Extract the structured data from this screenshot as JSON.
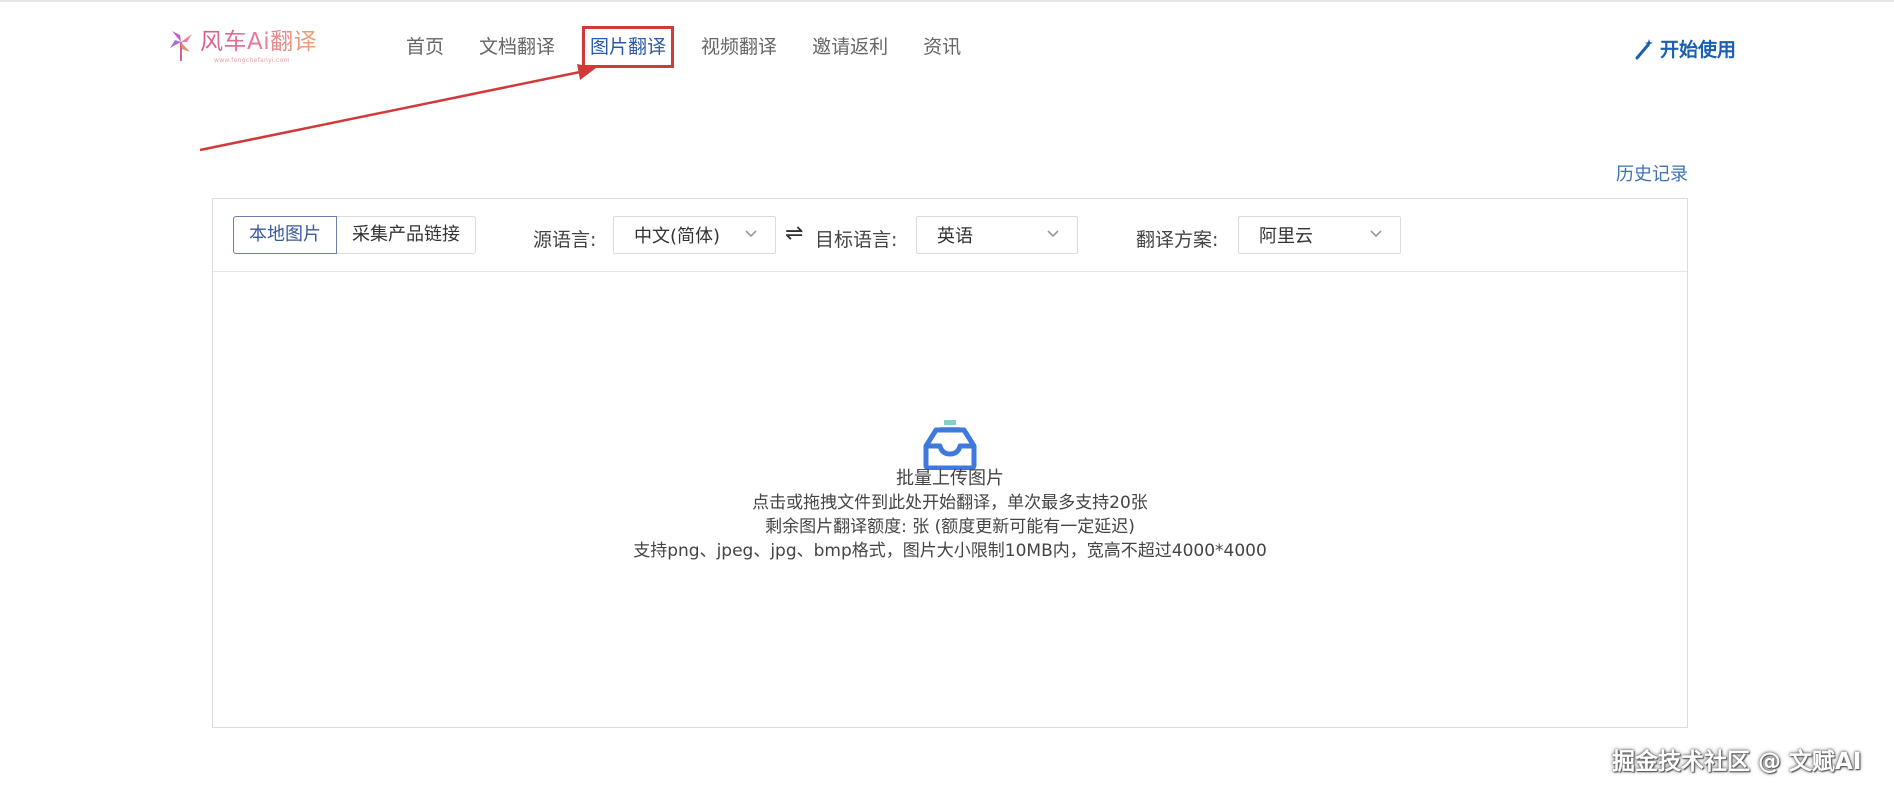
{
  "header": {
    "logo_text": "风车Ai翻译",
    "logo_subtext": "www.fengchefanyi.com",
    "nav": [
      {
        "label": "首页"
      },
      {
        "label": "文档翻译"
      },
      {
        "label": "图片翻译"
      },
      {
        "label": "视频翻译"
      },
      {
        "label": "邀请返利"
      },
      {
        "label": "资讯"
      }
    ],
    "start_label": "开始使用"
  },
  "history_label": "历史记录",
  "toolbar": {
    "tabs": [
      {
        "label": "本地图片"
      },
      {
        "label": "采集产品链接"
      }
    ],
    "source_label": "源语言:",
    "source_value": "中文(简体)",
    "swap_symbol": "⇌",
    "target_label": "目标语言:",
    "target_value": "英语",
    "plan_label": "翻译方案:",
    "plan_value": "阿里云"
  },
  "upload": {
    "title": "批量上传图片",
    "line1": "点击或拖拽文件到此处开始翻译，单次最多支持20张",
    "line2": "剩余图片翻译额度: 张 (额度更新可能有一定延迟)",
    "line3": "支持png、jpeg、jpg、bmp格式，图片大小限制10MB内，宽高不超过4000*4000"
  },
  "watermark": "掘金技术社区 @ 文赋AI",
  "colors": {
    "accent": "#2a5aa9",
    "highlight_box": "#d23a3a",
    "start_button": "#1a5fb4",
    "link": "#3d73b5"
  },
  "icons": {
    "logo": "windmill-icon",
    "start": "magic-wand-icon",
    "select": "chevron-down-icon",
    "upload": "inbox-icon"
  }
}
